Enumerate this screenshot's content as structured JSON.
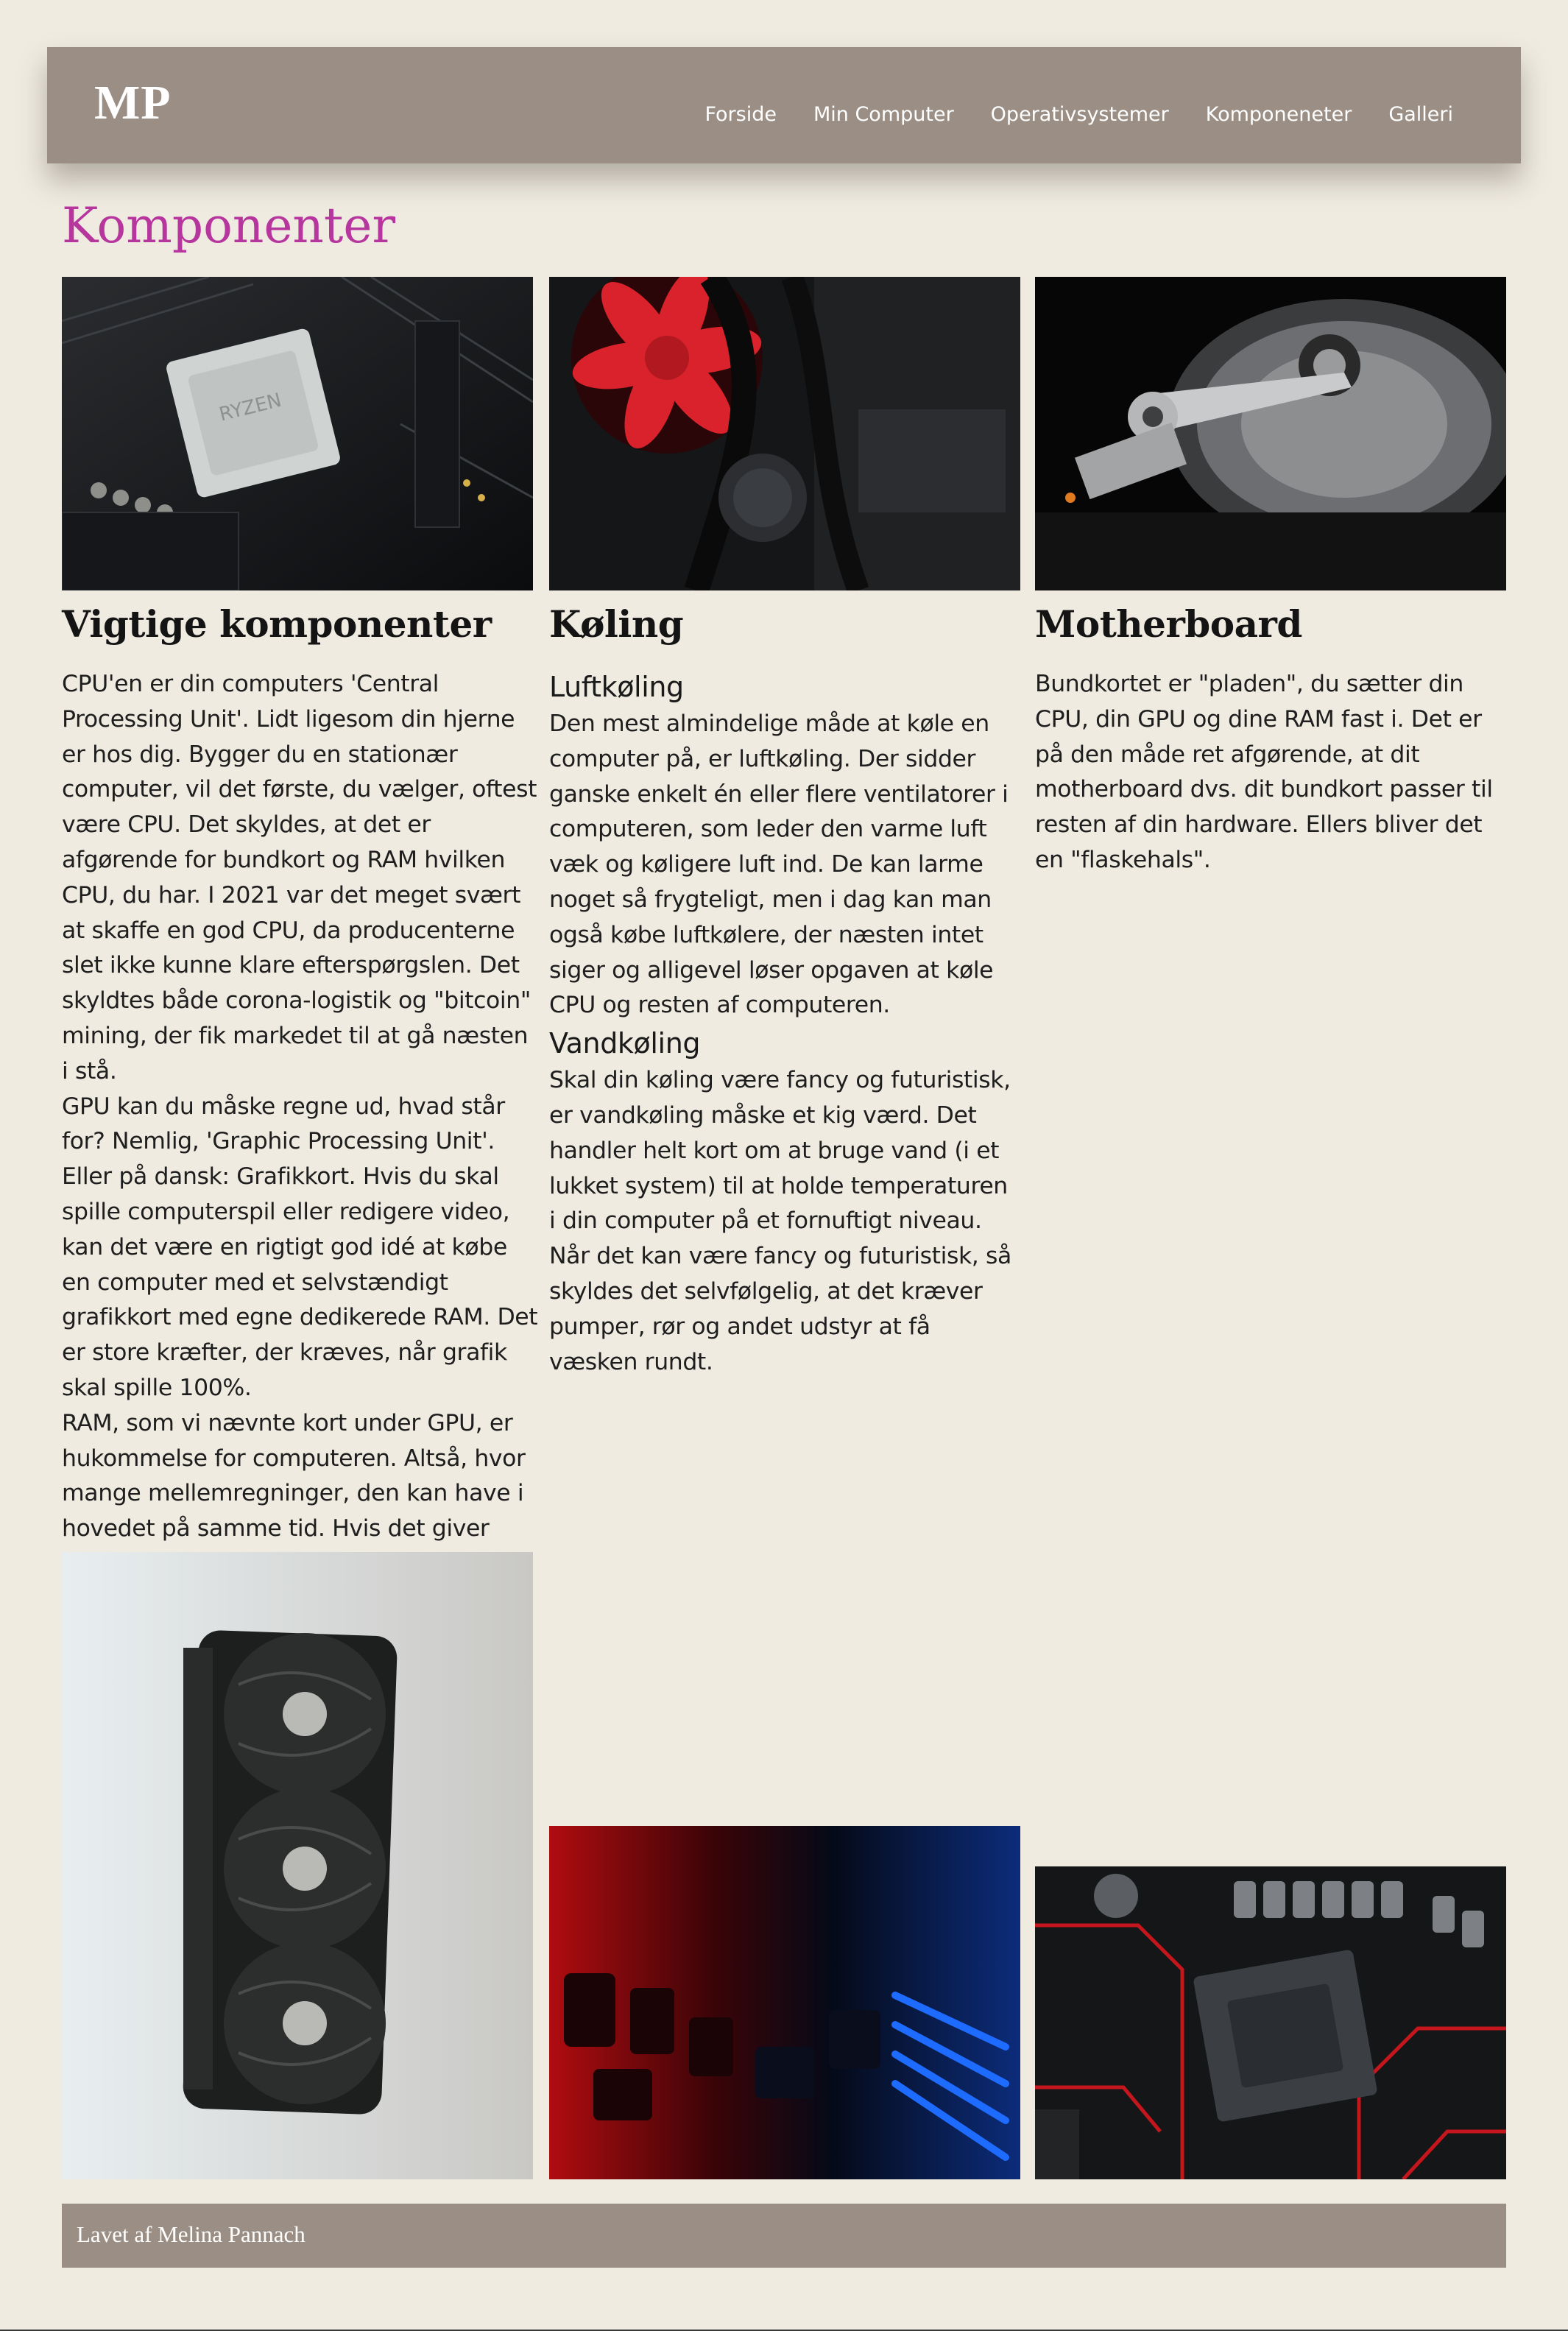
{
  "header": {
    "logo": "MP",
    "nav": [
      "Forside",
      "Min Computer",
      "Operativsystemer",
      "Komponeneter",
      "Galleri"
    ]
  },
  "page_title": "Komponenter",
  "columns": [
    {
      "title": "Vigtige komponenter",
      "paragraphs": [
        "CPU'en er din computers 'Central Processing Unit'. Lidt ligesom din hjerne er hos dig. Bygger du en stationær computer, vil det første, du vælger, oftest være CPU. Det skyldes, at det er afgørende for bundkort og RAM hvilken CPU, du har. I 2021 var det meget svært at skaffe en god CPU, da producenterne slet ikke kunne klare efterspørgslen. Det skyldtes både corona-logistik og \"bitcoin\" mining, der fik markedet til at gå næsten i stå.",
        "GPU kan du måske regne ud, hvad står for? Nemlig, 'Graphic Processing Unit'. Eller på dansk: Grafikkort. Hvis du skal spille computerspil eller redigere video, kan det være en rigtigt god idé at købe en computer med et selvstændigt grafikkort med egne dedikerede RAM. Det er store kræfter, der kræves, når grafik skal spille 100%.",
        "RAM, som vi nævnte kort under GPU, er hukommelse for computeren. Altså, hvor mange mellemregninger, den kan have i hovedet på samme tid. Hvis det giver mening. RAM er en forkortelse for 'Random Access Memory'."
      ]
    },
    {
      "title": "Køling",
      "sections": [
        {
          "heading": "Luftkøling",
          "text": "Den mest almindelige måde at køle en computer på, er luftkøling. Der sidder ganske enkelt én eller flere ventilatorer i computeren, som leder den varme luft væk og køligere luft ind. De kan larme noget så frygteligt, men i dag kan man også købe luftkølere, der næsten intet siger og alligevel løser opgaven at køle CPU og resten af computeren."
        },
        {
          "heading": "Vandkøling",
          "text": "Skal din køling være fancy og futuristisk, er vandkøling måske et kig værd. Det handler helt kort om at bruge vand (i et lukket system) til at holde temperaturen i din computer på et fornuftigt niveau. Når det kan være fancy og futuristisk, så skyldes det selvfølgelig, at det kræver pumper, rør og andet udstyr at få væsken rundt."
        }
      ]
    },
    {
      "title": "Motherboard",
      "paragraphs": [
        "Bundkortet er \"pladen\", du sætter din CPU, din GPU og dine RAM fast i. Det er på den måde ret afgørende, at dit motherboard dvs. dit bundkort passer til resten af din hardware. Ellers bliver det en \"flaskehals\"."
      ]
    }
  ],
  "footer": "Lavet af Melina Pannach"
}
